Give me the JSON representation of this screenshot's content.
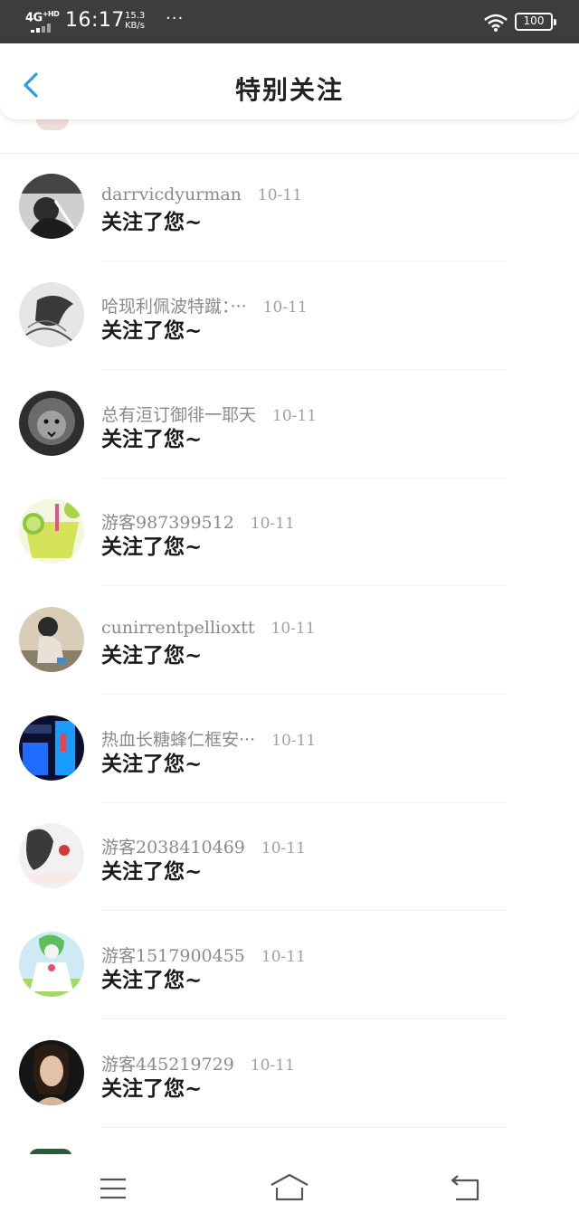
{
  "status_bar": {
    "network": "4G",
    "network_sup": "+HD",
    "time": "16:17",
    "speed_value": "15.3",
    "speed_unit": "KB/s",
    "more": "···",
    "battery": "100"
  },
  "header": {
    "title": "特别关注",
    "back_icon": "chevron-left-icon"
  },
  "colors": {
    "accent": "#2a9ee8",
    "status_bar_bg": "#3d3d3d",
    "username": "#8a8a8a",
    "message": "#1a1a1a"
  },
  "items": [
    {
      "username": "darrvicdyurman",
      "date": "10-11",
      "message": "关注了您~"
    },
    {
      "username": "哈现利佩波特蹴：···",
      "date": "10-11",
      "message": "关注了您~"
    },
    {
      "username": "总有洹订御徘一耶天",
      "date": "10-11",
      "message": "关注了您~"
    },
    {
      "username": "游客987399512",
      "date": "10-11",
      "message": "关注了您~"
    },
    {
      "username": "cunirrentpellioxtt",
      "date": "10-11",
      "message": "关注了您~"
    },
    {
      "username": "热血长糖蜂仁框安···",
      "date": "10-11",
      "message": "关注了您~"
    },
    {
      "username": "游客2038410469",
      "date": "10-11",
      "message": "关注了您~"
    },
    {
      "username": "游客1517900455",
      "date": "10-11",
      "message": "关注了您~"
    },
    {
      "username": "游客445219729",
      "date": "10-11",
      "message": "关注了您~"
    }
  ],
  "nav": {
    "menu_icon": "menu-icon",
    "home_icon": "home-icon",
    "back_icon": "return-icon"
  }
}
